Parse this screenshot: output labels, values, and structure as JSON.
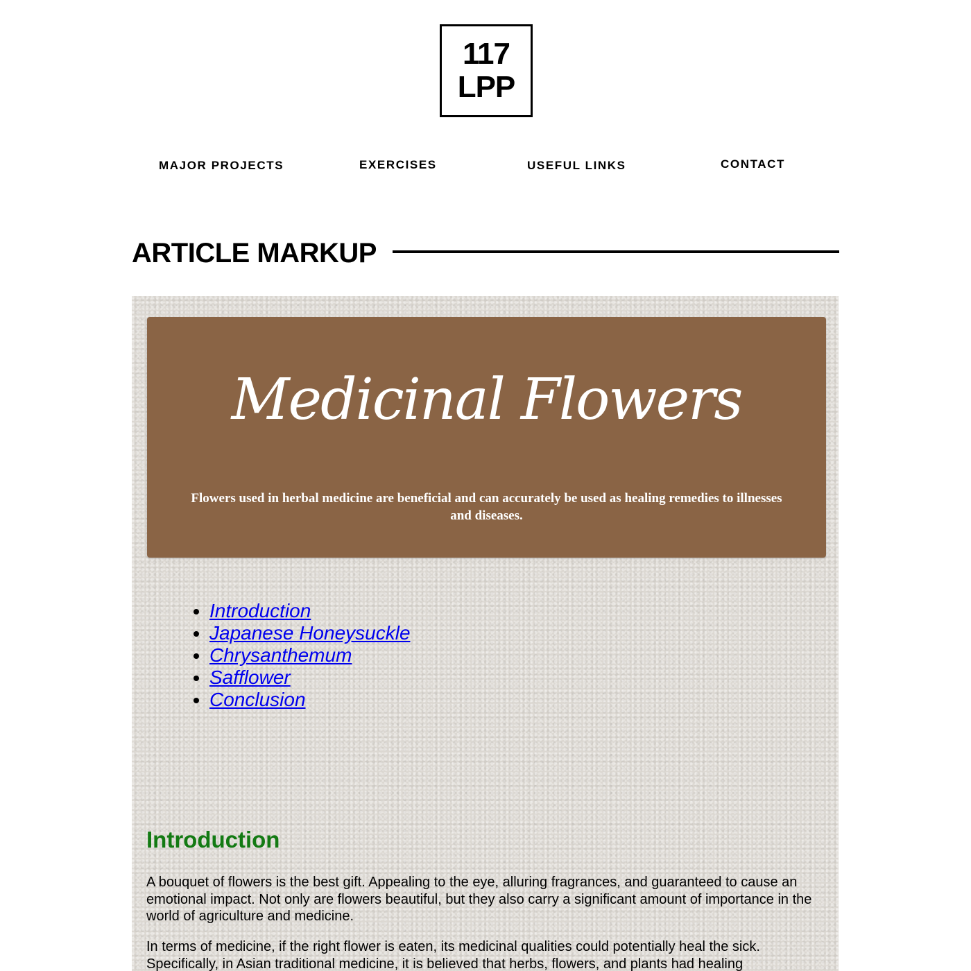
{
  "logo": {
    "line1": "117",
    "line2": "LPP"
  },
  "nav": {
    "items": [
      {
        "label": "MAJOR PROJECTS"
      },
      {
        "label": "EXERCISES"
      },
      {
        "label": "USEFUL LINKS"
      },
      {
        "label": "CONTACT"
      }
    ]
  },
  "section": {
    "title": "ARTICLE MARKUP"
  },
  "article": {
    "hero_title": "Medicinal Flowers",
    "hero_subtitle": "Flowers used in herbal medicine are beneficial and can accurately be used as healing remedies to illnesses and diseases.",
    "toc": [
      {
        "label": "Introduction"
      },
      {
        "label": "Japanese Honeysuckle"
      },
      {
        "label": "Chrysanthemum"
      },
      {
        "label": "Safflower"
      },
      {
        "label": "Conclusion"
      }
    ],
    "intro_heading": "Introduction",
    "paragraphs": [
      "A bouquet of flowers is the best gift. Appealing to the eye, alluring fragrances, and guaranteed to cause an emotional impact. Not only are flowers beautiful, but they also carry a significant amount of importance in the world of agriculture and medicine.",
      "In terms of medicine, if the right flower is eaten, its medicinal qualities could potentially heal the sick. Specifically, in Asian traditional medicine, it is believed that herbs, flowers, and plants had healing"
    ]
  },
  "colors": {
    "hero_bg": "#8a6445",
    "heading_green": "#137a13",
    "link_blue": "#0000ee",
    "paper_bg": "#dcd8d2"
  }
}
